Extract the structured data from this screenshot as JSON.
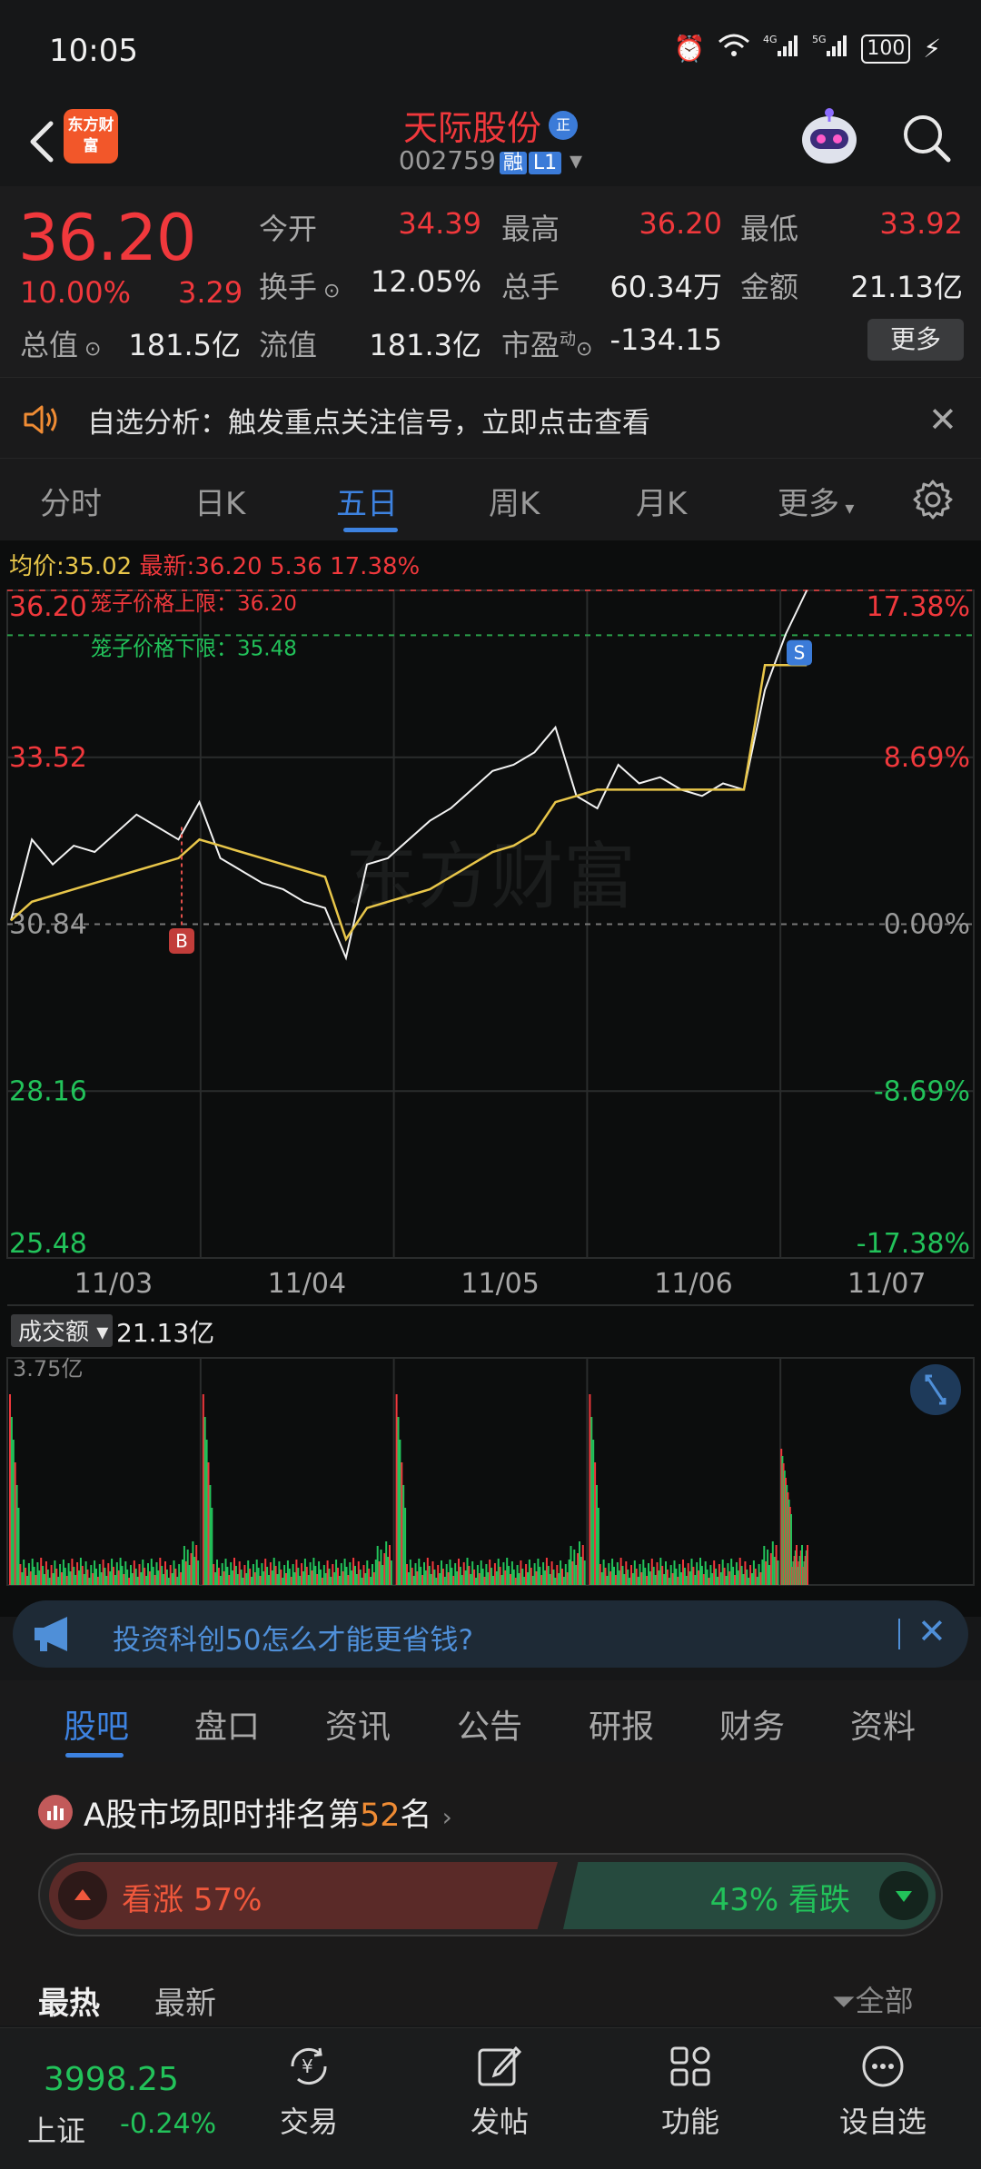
{
  "status": {
    "time": "10:05",
    "battery": "100"
  },
  "header": {
    "app_logo_text": "东方财富",
    "stock_name": "天际股份",
    "badge": "正",
    "code": "002759",
    "tag_margin": "融",
    "tag_level": "L1"
  },
  "quote": {
    "price": "36.20",
    "pct_change": "10.00%",
    "amt_change": "3.29",
    "open_label": "今开",
    "open": "34.39",
    "high_label": "最高",
    "high": "36.20",
    "low_label": "最低",
    "low": "33.92",
    "turnover_label": "换手",
    "turnover": "12.05%",
    "volume_label": "总手",
    "volume": "60.34万",
    "amount_label": "金额",
    "amount": "21.13亿",
    "mcap_label": "总值",
    "mcap": "181.5亿",
    "float_label": "流值",
    "float": "181.3亿",
    "pe_label": "市盈",
    "pe_sup": "动",
    "pe": "-134.15",
    "more": "更多"
  },
  "signal": {
    "text": "自选分析：触发重点关注信号，立即点击查看"
  },
  "period_tabs": [
    "分时",
    "日K",
    "五日",
    "周K",
    "月K",
    "更多"
  ],
  "chart": {
    "avg_label": "均价:",
    "avg": "35.02",
    "latest_label": "最新:",
    "latest": "36.20",
    "latest_chg": "5.36",
    "latest_pct": "17.38%",
    "limit_up_text": "笼子价格上限：36.20",
    "limit_down_text": "笼子价格下限：35.48",
    "marker_b": "B",
    "marker_s": "S",
    "watermark": "东方财富",
    "volume_label": "成交额",
    "volume_value": "21.13亿",
    "volume_max": "3.75亿"
  },
  "chart_data": {
    "type": "line",
    "y_price_ticks": [
      "36.20",
      "33.52",
      "30.84",
      "28.16",
      "25.48"
    ],
    "y_pct_ticks": [
      "17.38%",
      "8.69%",
      "0.00%",
      "-8.69%",
      "-17.38%"
    ],
    "x_labels": [
      "11/03",
      "11/04",
      "11/05",
      "11/06",
      "11/07"
    ],
    "ylim": [
      25.48,
      36.2
    ],
    "series": [
      {
        "name": "最新",
        "values": [
          30.9,
          32.2,
          31.8,
          32.1,
          32.0,
          32.3,
          32.6,
          32.4,
          32.2,
          32.8,
          31.9,
          31.7,
          31.5,
          31.4,
          31.2,
          31.1,
          30.3,
          31.8,
          31.9,
          32.2,
          32.5,
          32.7,
          33.0,
          33.3,
          33.4,
          33.6,
          34.0,
          32.9,
          32.7,
          33.4,
          33.1,
          33.2,
          33.0,
          32.9,
          33.1,
          33.0,
          34.6,
          35.5,
          36.2
        ]
      },
      {
        "name": "均价",
        "values": [
          30.9,
          31.2,
          31.3,
          31.4,
          31.5,
          31.6,
          31.7,
          31.8,
          31.9,
          32.2,
          32.1,
          32.0,
          31.9,
          31.8,
          31.7,
          31.6,
          30.6,
          31.1,
          31.2,
          31.3,
          31.4,
          31.6,
          31.8,
          32.0,
          32.1,
          32.3,
          32.8,
          32.9,
          33.0,
          33.0,
          33.0,
          33.0,
          33.0,
          33.0,
          33.0,
          33.0,
          35.0,
          35.0,
          35.0
        ]
      }
    ]
  },
  "ad": {
    "text": "投资科创50怎么才能更省钱?"
  },
  "content_tabs": [
    "股吧",
    "盘口",
    "资讯",
    "公告",
    "研报",
    "财务",
    "资料"
  ],
  "ranking": {
    "prefix": "A股市场即时排名第",
    "rank": "52",
    "suffix": "名"
  },
  "sentiment": {
    "bull_label": "看涨",
    "bull_pct": "57%",
    "bear_pct": "43%",
    "bear_label": "看跌"
  },
  "sort": {
    "hot": "最热",
    "new": "最新",
    "filter": "全部"
  },
  "bottom_nav": {
    "index_value": "3998.25",
    "index_name": "上证",
    "index_change": "-0.24%",
    "items": [
      "交易",
      "发帖",
      "功能",
      "设自选"
    ]
  }
}
